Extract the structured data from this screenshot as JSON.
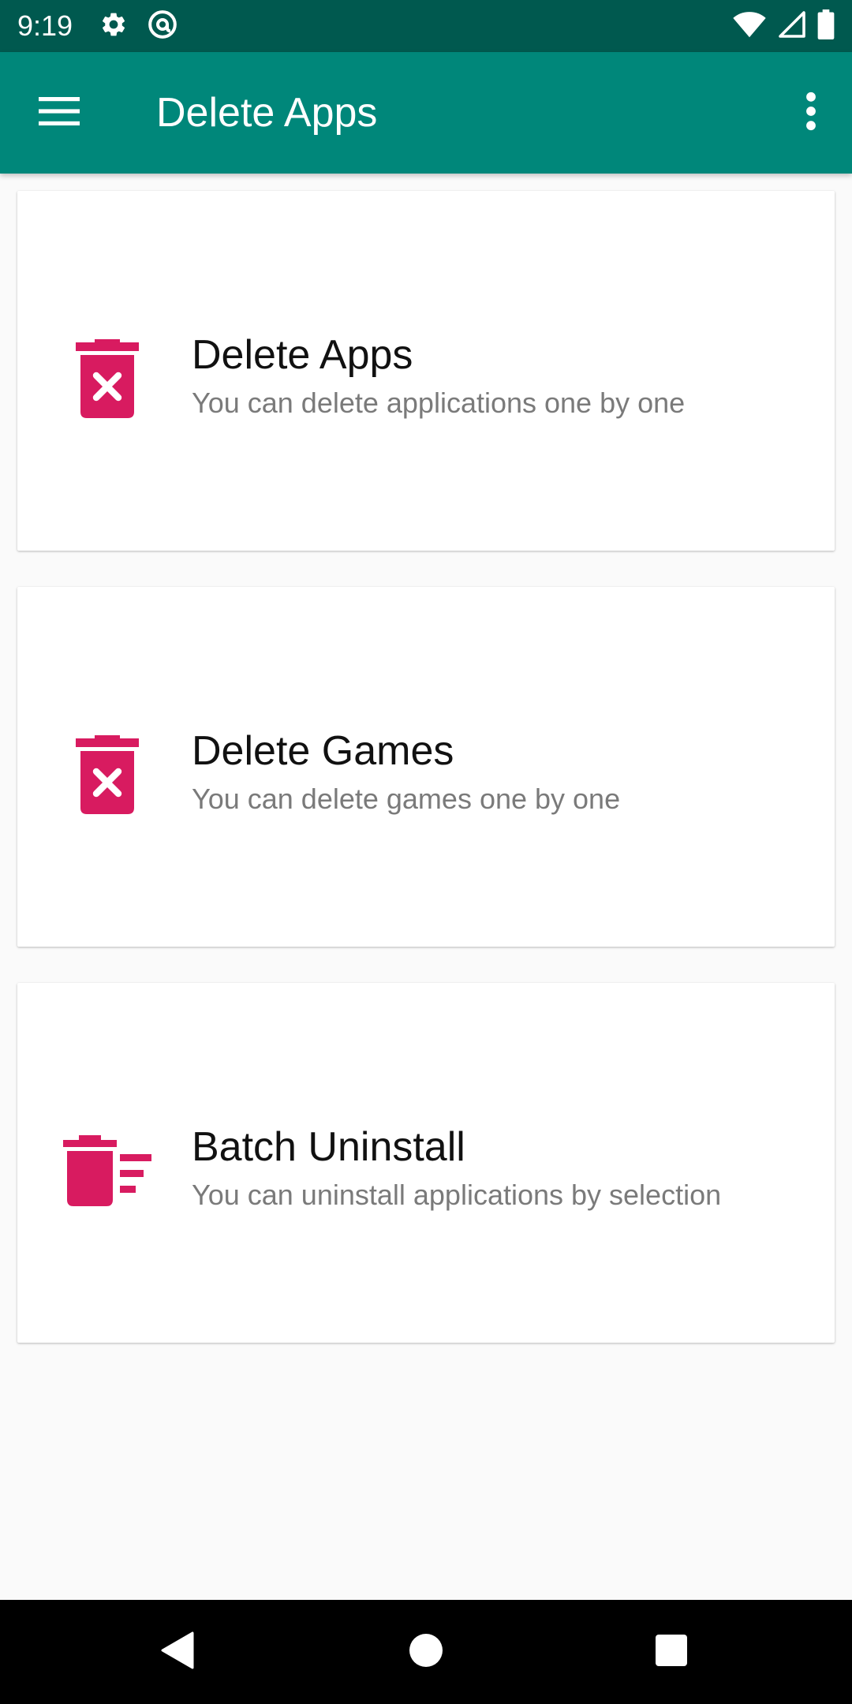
{
  "status_bar": {
    "time": "9:19",
    "left_icons": [
      "gear-icon",
      "at-sign-icon"
    ],
    "right_icons": [
      "wifi-icon",
      "cell-signal-icon",
      "battery-icon"
    ]
  },
  "app_bar": {
    "title": "Delete Apps",
    "menu_icon": "hamburger-menu-icon",
    "overflow_icon": "more-vert-icon",
    "color": "#00877a",
    "status_color": "#00594f"
  },
  "cards": [
    {
      "title": "Delete Apps",
      "subtitle": "You can delete applications one by one",
      "icon": "trash-x-icon"
    },
    {
      "title": "Delete Games",
      "subtitle": "You can delete games one by one",
      "icon": "trash-x-icon"
    },
    {
      "title": "Batch Uninstall",
      "subtitle": "You can uninstall applications by selection",
      "icon": "trash-list-icon"
    }
  ],
  "icon_color": "#d81b60",
  "nav_bar": {
    "buttons": [
      "back-icon",
      "home-icon",
      "recents-icon"
    ]
  }
}
